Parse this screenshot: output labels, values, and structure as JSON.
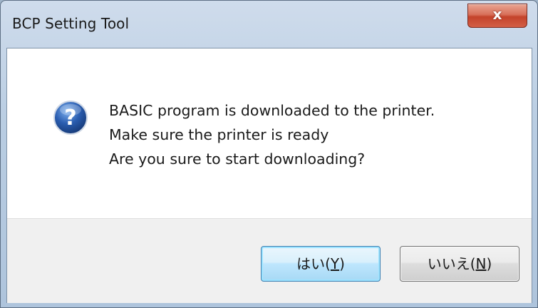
{
  "window": {
    "title": "BCP Setting Tool",
    "close_label": "x"
  },
  "icon": "question-icon",
  "message": {
    "lines": [
      "BASIC program is downloaded to the printer.",
      "Make sure the printer is ready",
      "Are you sure to start downloading?"
    ]
  },
  "buttons": {
    "yes": {
      "pre": "はい(",
      "key": "Y",
      "post": ")"
    },
    "no": {
      "pre": "いいえ(",
      "key": "N",
      "post": ")"
    }
  },
  "colors": {
    "icon_blue": "#2a5db0",
    "default_button_border": "#3c7fb1"
  }
}
